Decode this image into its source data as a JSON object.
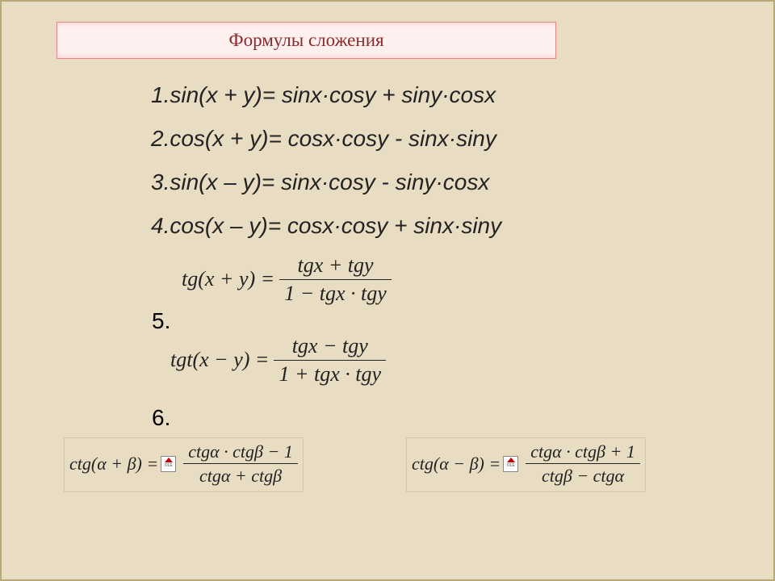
{
  "slide": {
    "title": "Формулы сложения",
    "lines": {
      "l1": "1.sin(x + y)= sinx·cosy + siny·cosx",
      "l2": "2.cos(x + y)= cosx·cosy - sinx·siny",
      "l3": "3.sin(x – y)= sinx·cosy - siny·cosx",
      "l4": "4.cos(x – y)= cosx·cosy + sinx·siny"
    },
    "num5": "5.",
    "num6": "6.",
    "tg5": {
      "lhs": "tg(x + y) =",
      "num": "tgx + tgy",
      "den": "1 − tgx · tgy"
    },
    "tg6": {
      "lhs": "tgt(x − y) =",
      "num": "tgx − tgy",
      "den": "1 + tgx · tgy"
    },
    "ctg_left": {
      "lhs": "ctg(α + β) =",
      "num": "ctgα · ctgβ − 1",
      "den": "ctgα + ctgβ"
    },
    "ctg_right": {
      "lhs": "ctg(α − β) =",
      "num": "ctgα · ctgβ + 1",
      "den": "ctgβ − ctgα"
    },
    "ole_label": "OLE"
  }
}
